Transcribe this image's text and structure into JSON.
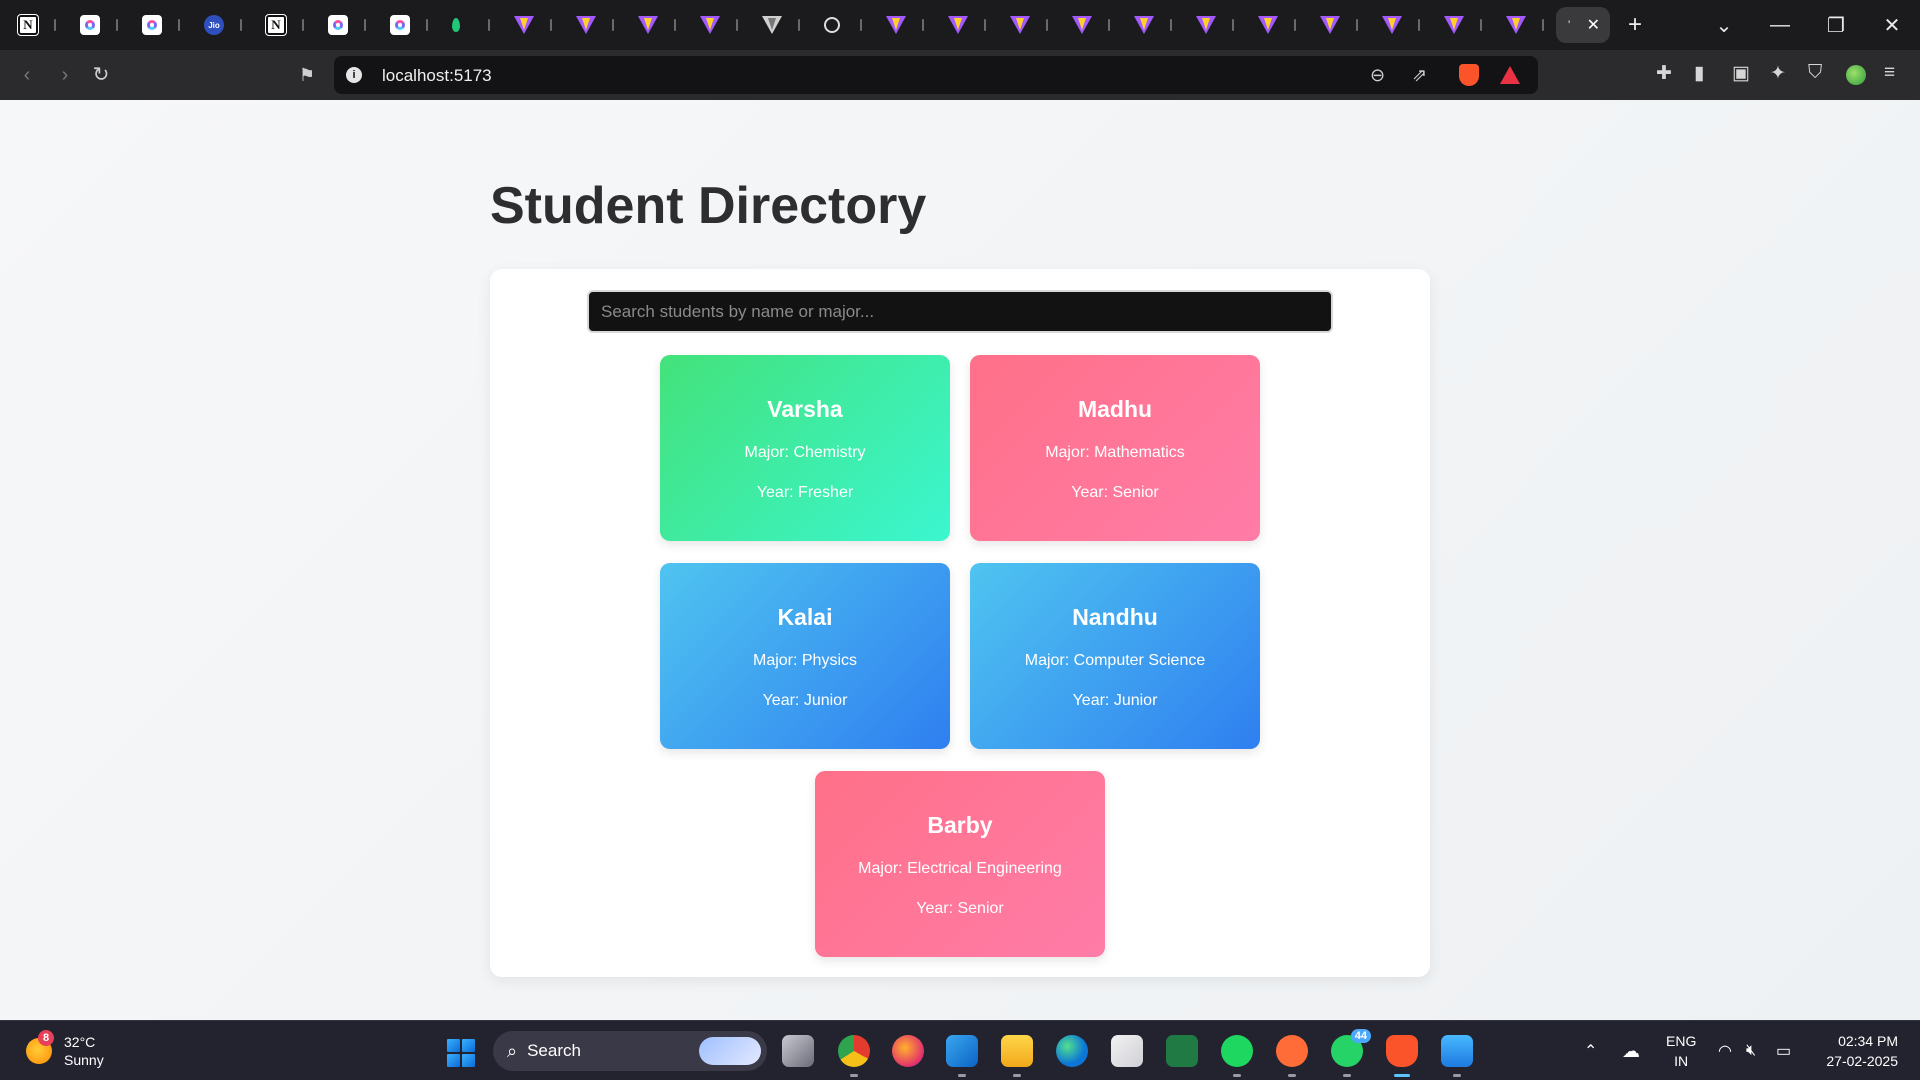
{
  "browser": {
    "tabs": [
      {
        "icon": "notion-icon"
      },
      {
        "icon": "clickup-icon"
      },
      {
        "icon": "clickup-icon"
      },
      {
        "icon": "jio-icon",
        "label": "Jio"
      },
      {
        "icon": "notion-icon"
      },
      {
        "icon": "clickup-icon"
      },
      {
        "icon": "clickup-icon"
      },
      {
        "icon": "leaf-icon"
      },
      {
        "icon": "vite-icon"
      },
      {
        "icon": "vite-icon"
      },
      {
        "icon": "vite-icon"
      },
      {
        "icon": "vite-icon"
      },
      {
        "icon": "vite-grey-icon"
      },
      {
        "icon": "globe-icon"
      },
      {
        "icon": "vite-icon"
      },
      {
        "icon": "vite-icon"
      },
      {
        "icon": "vite-icon"
      },
      {
        "icon": "vite-icon"
      },
      {
        "icon": "vite-icon"
      },
      {
        "icon": "vite-icon"
      },
      {
        "icon": "vite-icon"
      },
      {
        "icon": "vite-icon"
      },
      {
        "icon": "vite-icon"
      },
      {
        "icon": "vite-icon"
      },
      {
        "icon": "vite-icon"
      }
    ],
    "active_tab_close": "✕",
    "new_tab": "+",
    "url": "localhost:5173"
  },
  "page": {
    "title": "Student Directory",
    "search": {
      "placeholder": "Search students by name or major...",
      "value": ""
    },
    "students": [
      {
        "name": "Varsha",
        "major": "Major: Chemistry",
        "year": "Year: Fresher",
        "color": "green"
      },
      {
        "name": "Madhu",
        "major": "Major: Mathematics",
        "year": "Year: Senior",
        "color": "pink"
      },
      {
        "name": "Kalai",
        "major": "Major: Physics",
        "year": "Year: Junior",
        "color": "blue"
      },
      {
        "name": "Nandhu",
        "major": "Major: Computer Science",
        "year": "Year: Junior",
        "color": "blue"
      },
      {
        "name": "Barby",
        "major": "Major: Electrical Engineering",
        "year": "Year: Senior",
        "color": "pink"
      }
    ]
  },
  "taskbar": {
    "weather": {
      "badge": "8",
      "temp": "32°C",
      "condition": "Sunny"
    },
    "search_label": "Search",
    "whatsapp_badge": "44",
    "language": {
      "line1": "ENG",
      "line2": "IN"
    },
    "time": "02:34 PM",
    "date": "27-02-2025"
  },
  "colors": {
    "card_green": "#43e27a",
    "card_pink": "#ff7088",
    "card_blue": "#2f7ff0"
  }
}
